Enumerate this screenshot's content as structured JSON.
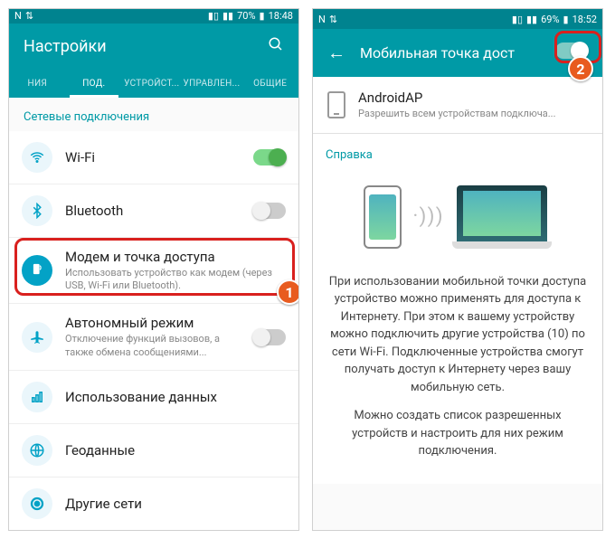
{
  "left": {
    "status": {
      "battery": "70%",
      "time": "18:48"
    },
    "header": {
      "title": "Настройки"
    },
    "tabs": [
      "НИЯ",
      "ПОД.",
      "УСТРОЙСТ...",
      "УПРАВЛЕН...",
      "ОБЩИЕ"
    ],
    "activeTab": 1,
    "section": "Сетевые подключения",
    "items": {
      "wifi": {
        "title": "Wi-Fi"
      },
      "bluetooth": {
        "title": "Bluetooth"
      },
      "tether": {
        "title": "Модем и точка доступа",
        "sub": "Использовать устройство как модем (через USB, Wi-Fi или Bluetooth)."
      },
      "airplane": {
        "title": "Автономный режим",
        "sub": "Отключение функций вызовов, а также обмена сообщениями..."
      },
      "datausage": {
        "title": "Использование данных"
      },
      "geo": {
        "title": "Геоданные"
      },
      "other": {
        "title": "Другие сети"
      }
    },
    "badge": "1"
  },
  "right": {
    "status": {
      "battery": "69%",
      "time": "18:52"
    },
    "header": {
      "title": "Мобильная точка дост"
    },
    "ap": {
      "name": "AndroidAP",
      "sub": "Разрешить всем устройствам подключа..."
    },
    "help": {
      "label": "Справка",
      "p1": "При использовании мобильной точки доступа устройство можно применять для доступа к Интернету. При этом к вашему устройству можно подключить другие устройства (10) по сети Wi-Fi. Подключенные устройства смогут получать доступ к Интернету через вашу мобильную сеть.",
      "p2": "Можно создать список разрешенных устройств и настроить для них режим подключения."
    },
    "badge": "2"
  }
}
